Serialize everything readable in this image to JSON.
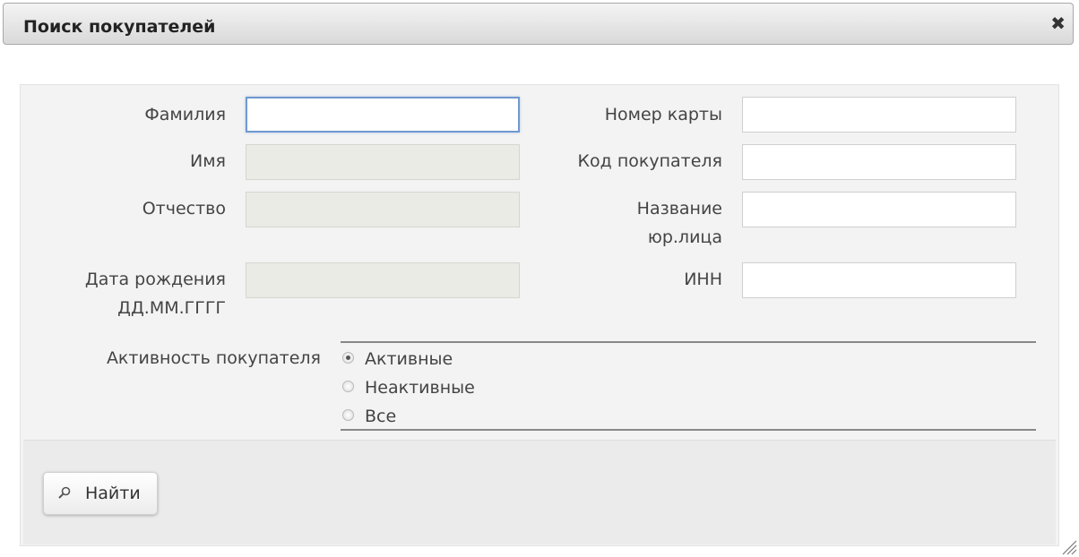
{
  "dialog": {
    "title": "Поиск покупателей",
    "close_glyph": "✖"
  },
  "form": {
    "last_name": {
      "label": "Фамилия",
      "value": ""
    },
    "first_name": {
      "label": "Имя",
      "value": ""
    },
    "patronymic": {
      "label": "Отчество",
      "value": ""
    },
    "birth_date": {
      "label_line1": "Дата рождения",
      "label_line2": "ДД.ММ.ГГГГ",
      "value": ""
    },
    "card_number": {
      "label": "Номер карты",
      "value": ""
    },
    "customer_code": {
      "label": "Код покупателя",
      "value": ""
    },
    "legal_name": {
      "label_line1": "Название",
      "label_line2": "юр.лица",
      "value": ""
    },
    "inn": {
      "label": "ИНН",
      "value": ""
    }
  },
  "activity": {
    "label": "Активность покупателя",
    "options": [
      {
        "label": "Активные",
        "selected": true
      },
      {
        "label": "Неактивные",
        "selected": false
      },
      {
        "label": "Все",
        "selected": false
      }
    ]
  },
  "search_button": {
    "label": "Найти",
    "icon": "search-icon"
  },
  "colors": {
    "focus_border": "#6f99cf",
    "disabled_field": "#ebebe6",
    "panel_bg": "#f3f3f3"
  }
}
